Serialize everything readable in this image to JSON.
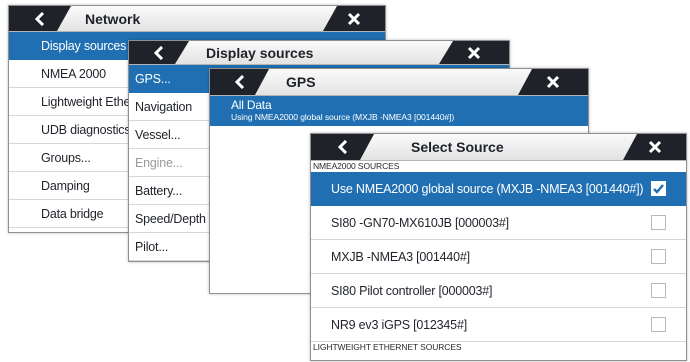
{
  "network": {
    "title": "Network",
    "items": [
      {
        "label": "Display sources",
        "selected": true
      },
      {
        "label": "NMEA 2000"
      },
      {
        "label": "Lightweight Ethernet"
      },
      {
        "label": "UDB diagnostics"
      },
      {
        "label": "Groups..."
      },
      {
        "label": "Damping"
      },
      {
        "label": "Data bridge"
      }
    ]
  },
  "display_sources": {
    "title": "Display sources",
    "items": [
      {
        "label": "GPS...",
        "selected": true
      },
      {
        "label": "Navigation"
      },
      {
        "label": "Vessel..."
      },
      {
        "label": "Engine...",
        "disabled": true
      },
      {
        "label": "Battery..."
      },
      {
        "label": "Speed/Depth"
      },
      {
        "label": "Pilot..."
      }
    ]
  },
  "gps": {
    "title": "GPS",
    "items": [
      {
        "label": "All Data",
        "sublabel": "Using NMEA2000 global source (MXJB -NMEA3 [001440#])",
        "selected": true
      }
    ]
  },
  "select_source": {
    "title": "Select Source",
    "section_nmea": "NMEA2000 SOURCES",
    "section_ethernet": "LIGHTWEIGHT ETHERNET SOURCES",
    "items": [
      {
        "label": "Use NMEA2000 global source (MXJB -NMEA3 [001440#])",
        "checked": true,
        "selected": true
      },
      {
        "label": "SI80 -GN70-MX610JB [000003#]",
        "checked": false
      },
      {
        "label": "MXJB -NMEA3 [001440#]",
        "checked": false
      },
      {
        "label": "SI80 Pilot controller [000003#]",
        "checked": false
      },
      {
        "label": "NR9 ev3 iGPS [012345#]",
        "checked": false
      }
    ]
  },
  "icons": {
    "back": "chevron-left-icon",
    "close": "close-x-icon",
    "check": "checkmark-icon"
  },
  "colors": {
    "selected_row": "#1f6fb2",
    "tab_dark": "#1f2329",
    "title_bar": "#ececec"
  }
}
